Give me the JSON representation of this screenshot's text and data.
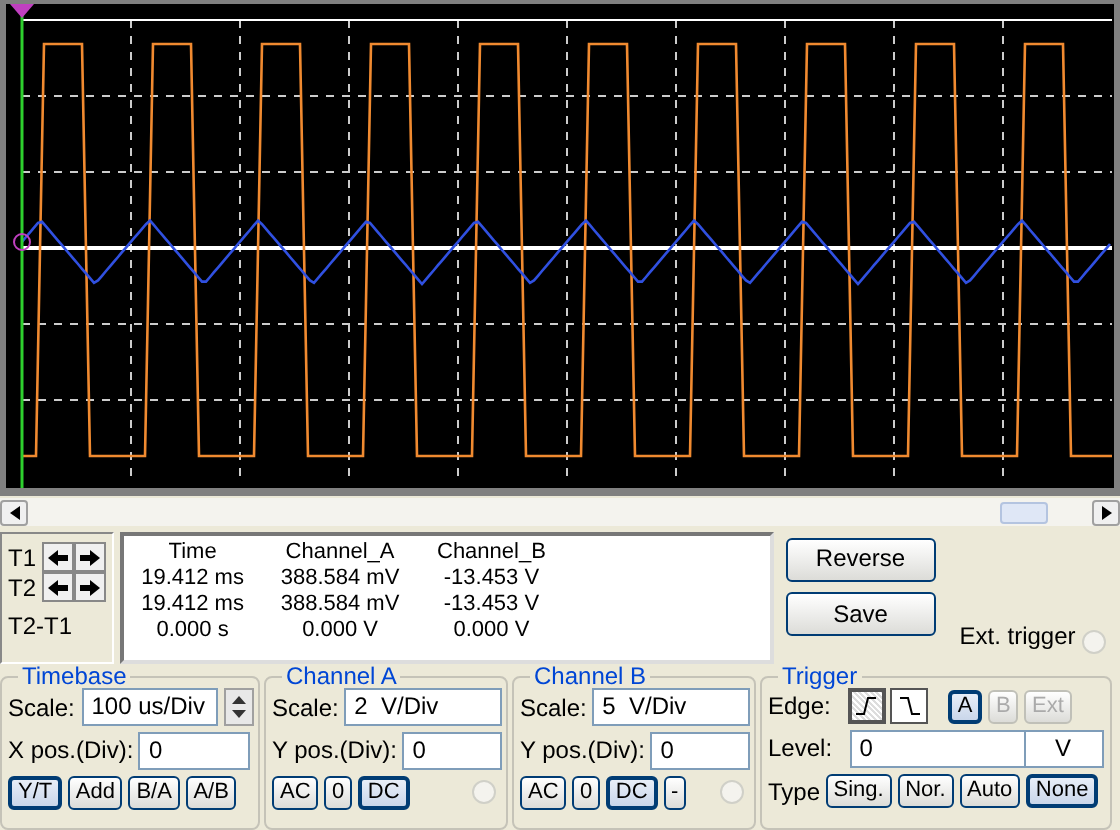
{
  "cursors": {
    "rows": [
      {
        "label": "T1"
      },
      {
        "label": "T2"
      }
    ],
    "diff_label": "T2-T1"
  },
  "readout": {
    "columns": [
      "Time",
      "Channel_A",
      "Channel_B"
    ],
    "rows": [
      [
        "19.412 ms",
        "388.584 mV",
        "-13.453 V"
      ],
      [
        "19.412 ms",
        "388.584 mV",
        "-13.453 V"
      ],
      [
        "0.000 s",
        "0.000 V",
        "0.000 V"
      ]
    ]
  },
  "buttons": [
    "Reverse",
    "Save"
  ],
  "ext_trigger": {
    "label": "Ext. trigger"
  },
  "timebase": {
    "title": "Timebase",
    "scale_label": "Scale:",
    "scale": "100 us/Div",
    "xpos_label": "X pos.(Div):",
    "xpos": "0",
    "modes": [
      {
        "label": "Y/T",
        "selected": true
      },
      {
        "label": "Add",
        "selected": false
      },
      {
        "label": "B/A",
        "selected": false
      },
      {
        "label": "A/B",
        "selected": false
      }
    ]
  },
  "channel_a": {
    "title": "Channel A",
    "scale_label": "Scale:",
    "scale": "2  V/Div",
    "ypos_label": "Y pos.(Div):",
    "ypos": "0",
    "coupling": [
      {
        "label": "AC",
        "selected": false
      },
      {
        "label": "0",
        "selected": false
      },
      {
        "label": "DC",
        "selected": true
      }
    ]
  },
  "channel_b": {
    "title": "Channel B",
    "scale_label": "Scale:",
    "scale": "5  V/Div",
    "ypos_label": "Y pos.(Div):",
    "ypos": "0",
    "coupling": [
      {
        "label": "AC",
        "selected": false
      },
      {
        "label": "0",
        "selected": false
      },
      {
        "label": "DC",
        "selected": true
      }
    ],
    "invert": {
      "label": "-",
      "selected": false
    }
  },
  "trigger": {
    "title": "Trigger",
    "edge_label": "Edge:",
    "edges": [
      {
        "kind": "rising",
        "selected": true
      },
      {
        "kind": "falling",
        "selected": false
      }
    ],
    "sources": [
      {
        "label": "A",
        "selected": true,
        "disabled": false
      },
      {
        "label": "B",
        "selected": false,
        "disabled": true
      },
      {
        "label": "Ext",
        "selected": false,
        "disabled": true
      }
    ],
    "level_label": "Level:",
    "level": "0",
    "level_unit": "V",
    "type_label": "Type",
    "types": [
      {
        "label": "Sing.",
        "selected": false
      },
      {
        "label": "Nor.",
        "selected": false
      },
      {
        "label": "Auto",
        "selected": false
      },
      {
        "label": "None",
        "selected": true
      }
    ]
  }
}
